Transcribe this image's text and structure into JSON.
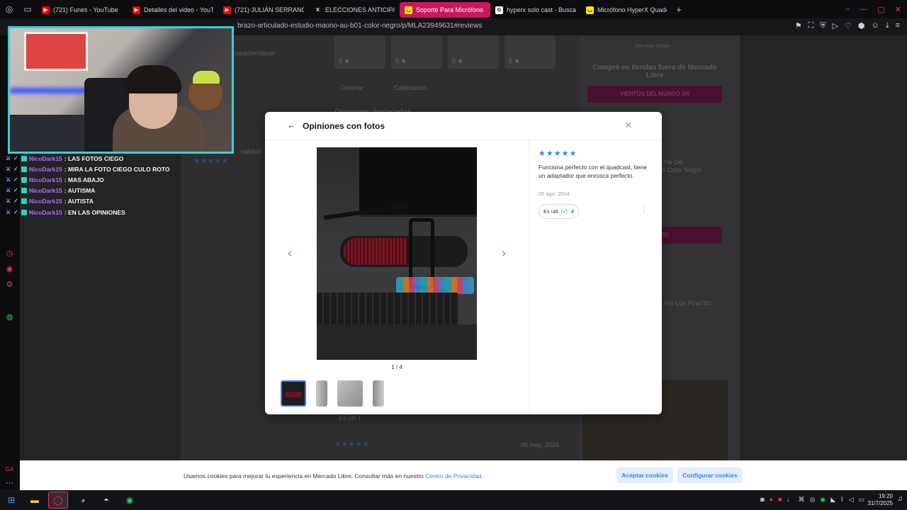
{
  "browser": {
    "tabs": [
      {
        "title": "(721) Funes - YouTube",
        "icon": "youtube-icon",
        "color": "#ff0000"
      },
      {
        "title": "Detalles del video - YouT",
        "icon": "youtube-icon",
        "color": "#ff0000"
      },
      {
        "title": "(721) JULIÁN SERRANO Y",
        "icon": "youtube-icon",
        "color": "#ff0000"
      },
      {
        "title": "ELECCIONES ANTICIPADA",
        "icon": "x-icon",
        "color": "#ffffff"
      },
      {
        "title": "Soporte Para Micrófono E",
        "icon": "mercadolibre-icon",
        "color": "#ffe600",
        "active": true
      },
      {
        "title": "hyperx solo cast - Busca",
        "icon": "google-icon",
        "color": "#ffffff"
      },
      {
        "title": "Micrófono HyperX Quadc",
        "icon": "mercadolibre-icon",
        "color": "#ffe600"
      }
    ],
    "new_tab": "+",
    "url": "brazo-articulado-estudio-maono-au-b01-color-negro/p/MLA23949631#reviews"
  },
  "background_page": {
    "features_label": "características",
    "thumb_scores": [
      "5 ★",
      "5 ★",
      "5 ★",
      "5 ★"
    ],
    "order_label": "Ordenar",
    "rating_label": "Calificación",
    "highlighted": "Opiniones destacadas",
    "quality_label": "calidad",
    "shops_title": "Mercado Shops",
    "shops_text": "Comprá en tiendas fuera de Mercado Libre",
    "shops_button": "VIENTOS DEL MUNDO SR",
    "similar_1": "Pie De",
    "similar_2": "6 Color Negro",
    "cable_button": "CABLEDO",
    "similar_3": "Pro Lox Pina780",
    "review_date": "06 may. 2024",
    "useful_small": "Es útil  1"
  },
  "chat": [
    {
      "user": "NicoDark15",
      "msg": ": LAS FOTOS CIEGO"
    },
    {
      "user": "NicoDark15",
      "msg": ": MIRA LA FOTO CIEGO CULO ROTO"
    },
    {
      "user": "NicoDark15",
      "msg": ": MAS ABAJO"
    },
    {
      "user": "NicoDark15",
      "msg": ": AUTISMA"
    },
    {
      "user": "NicoDark15",
      "msg": ": AUTISTA"
    },
    {
      "user": "NicoDark15",
      "msg": ": EN LAS OPINIONES"
    }
  ],
  "modal": {
    "title": "Opiniones con fotos",
    "counter": "1 / 4",
    "rating_stars": 5,
    "review_text": "Funciona perfecto con el quadcast, tiene un adaptador que enrosca perfecto.",
    "review_date": "05 ago. 2024",
    "useful_label": "Es útil",
    "useful_count": "4"
  },
  "cookie": {
    "text": "Usamos cookies para mejorar tu experiencia en Mercado Libre. Consultar más en nuestro ",
    "link": "Centro de Privacidad.",
    "accept": "Aceptar cookies",
    "configure": "Configurar cookies"
  },
  "taskbar": {
    "time": "19:20",
    "date": "31/7/2025"
  },
  "colors": {
    "accent": "#3483fa",
    "active_tab": "#c8195f",
    "chat_user": "#b06cff",
    "webcam_border": "#2fd3d8"
  }
}
